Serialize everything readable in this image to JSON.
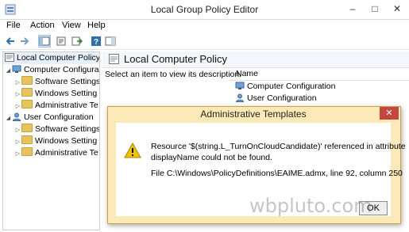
{
  "window": {
    "title": "Local Group Policy Editor",
    "minimize": "–",
    "maximize": "□",
    "close": "✕"
  },
  "menu": [
    "File",
    "Action",
    "View",
    "Help"
  ],
  "toolbar": {
    "icons": [
      "back-arrow-icon",
      "forward-arrow-icon",
      "show-hide-tree-icon",
      "properties-icon",
      "export-icon",
      "help-icon",
      "console-pane-icon"
    ]
  },
  "tree": {
    "root": "Local Computer Policy",
    "computer": {
      "label": "Computer Configura",
      "children": [
        "Software Settings",
        "Windows Setting",
        "Administrative Te"
      ]
    },
    "user": {
      "label": "User Configuration",
      "children": [
        "Software Settings",
        "Windows Setting",
        "Administrative Te"
      ]
    }
  },
  "right": {
    "header": "Local Computer Policy",
    "prompt": "Select an item to view its description.",
    "column": "Name",
    "items": [
      "Computer Configuration",
      "User Configuration"
    ]
  },
  "dialog": {
    "title": "Administrative Templates",
    "close": "✕",
    "message_line1": "Resource '$(string.L_TurnOnCloudCandidate)' referenced in attribute",
    "message_line2": "displayName could not be found.",
    "file_line": "File C:\\Windows\\PolicyDefinitions\\EAIME.admx, line 92, column 250",
    "ok": "OK"
  },
  "watermark": "wbpluto.com",
  "colors": {
    "dialog_frame": "#fbe9b7",
    "close_red": "#c7463d",
    "folder": "#e8c35b",
    "warning": "#f2c200"
  }
}
